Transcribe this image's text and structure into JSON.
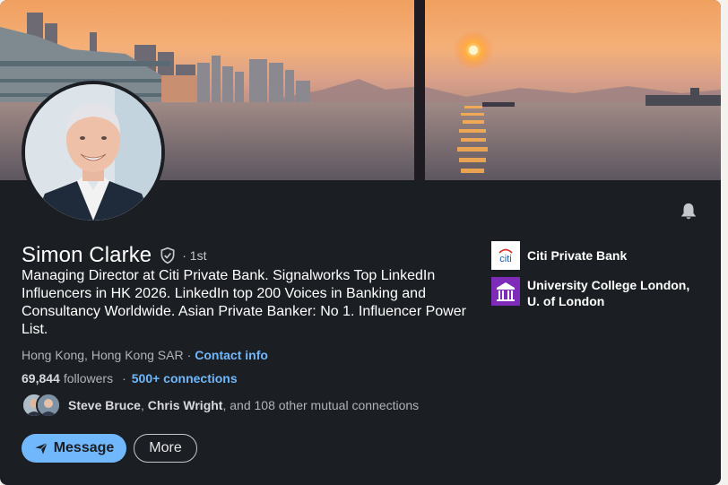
{
  "profile": {
    "name": "Simon Clarke",
    "degree": "· 1st",
    "headline": "Managing Director at Citi Private Bank. Signalworks Top LinkedIn Influencers in HK 2026. LinkedIn top 200 Voices in Banking and Consultancy Worldwide. Asian Private Banker: No 1. Influencer Power List.",
    "location": "Hong Kong, Hong Kong SAR",
    "location_separator": "·",
    "contact_info": "Contact info",
    "followers_count": "69,844",
    "followers_label": "followers",
    "connections_separator": "·",
    "connections": "500+ connections"
  },
  "mutual": {
    "name1": "Steve Bruce",
    "comma": ", ",
    "name2": "Chris Wright",
    "rest": ", and 108 other mutual connections"
  },
  "actions": {
    "message": "Message",
    "more": "More"
  },
  "orgs": [
    {
      "name": "Citi Private Bank",
      "logo_text": "citi",
      "icon": "citi-logo-icon"
    },
    {
      "name": "University College London, U. of London",
      "icon": "ucl-logo-icon"
    }
  ],
  "colors": {
    "card_bg": "#1b1f23",
    "link": "#71b7fb",
    "primary_button": "#71b7fb",
    "ucl_purple": "#7d2bb8"
  },
  "icons": {
    "bell": "bell-icon",
    "verified": "verified-shield-icon",
    "send": "send-icon"
  }
}
